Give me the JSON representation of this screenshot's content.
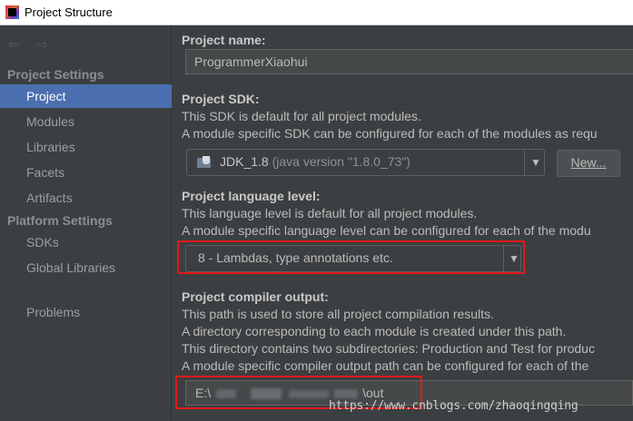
{
  "window": {
    "title": "Project Structure"
  },
  "nav": {
    "back_glyph": "⇦",
    "forward_glyph": "⇨"
  },
  "sidebar": {
    "project_settings_label": "Project Settings",
    "project_settings_items": [
      {
        "label": "Project",
        "selected": true
      },
      {
        "label": "Modules"
      },
      {
        "label": "Libraries"
      },
      {
        "label": "Facets"
      },
      {
        "label": "Artifacts"
      }
    ],
    "platform_settings_label": "Platform Settings",
    "platform_settings_items": [
      {
        "label": "SDKs"
      },
      {
        "label": "Global Libraries"
      }
    ],
    "other_items": [
      {
        "label": "Problems"
      }
    ]
  },
  "project_name": {
    "heading": "Project name:",
    "value": "ProgrammerXiaohui"
  },
  "project_sdk": {
    "heading": "Project SDK:",
    "desc1": "This SDK is default for all project modules.",
    "desc2": "A module specific SDK can be configured for each of the modules as requ",
    "selected_name": "JDK_1.8",
    "selected_detail": "(java version \"1.8.0_73\")",
    "new_button": "New..."
  },
  "language_level": {
    "heading": "Project language level:",
    "desc1": "This language level is default for all project modules.",
    "desc2": "A module specific language level can be configured for each of the modu",
    "selected": "8 - Lambdas, type annotations etc."
  },
  "compiler_output": {
    "heading": "Project compiler output:",
    "desc1": "This path is used to store all project compilation results.",
    "desc2": "A directory corresponding to each module is created under this path.",
    "desc3": "This directory contains two subdirectories: Production and Test for produc",
    "desc4": "A module specific compiler output path can be configured for each of the",
    "path_prefix": "E:\\",
    "path_suffix": "\\out"
  },
  "watermark": "https://www.cnblogs.com/zhaoqingqing",
  "colors": {
    "background": "#3c3f41",
    "selection": "#4b6eaf",
    "highlight_box": "#e0191b"
  }
}
